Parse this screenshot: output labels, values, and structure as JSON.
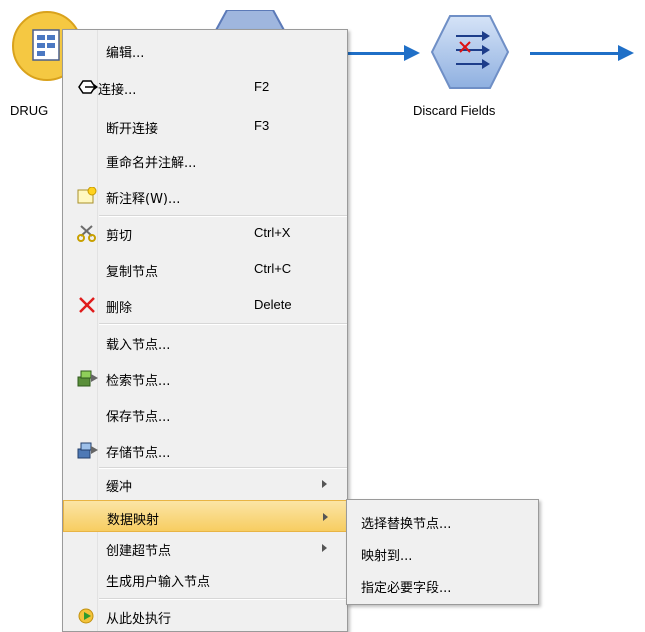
{
  "stream": {
    "source_node_label": "DRUG",
    "discard_node_label": "Discard Fields"
  },
  "menu": {
    "items": [
      {
        "label": "编辑...",
        "shortcut": ""
      },
      {
        "label": "连接...",
        "shortcut": "F2",
        "icon": "connect-icon"
      },
      {
        "label": "断开连接",
        "shortcut": "F3"
      },
      {
        "label": "重命名并注解...",
        "shortcut": ""
      },
      {
        "label": "新注释(W)...",
        "shortcut": "",
        "icon": "new-comment-icon"
      },
      {
        "label": "剪切",
        "shortcut": "Ctrl+X",
        "icon": "scissors-icon"
      },
      {
        "label": "复制节点",
        "shortcut": "Ctrl+C"
      },
      {
        "label": "删除",
        "shortcut": "Delete",
        "icon": "delete-icon"
      },
      {
        "label": "载入节点...",
        "shortcut": ""
      },
      {
        "label": "检索节点...",
        "shortcut": "",
        "icon": "retrieve-icon"
      },
      {
        "label": "保存节点...",
        "shortcut": ""
      },
      {
        "label": "存储节点...",
        "shortcut": "",
        "icon": "store-icon"
      },
      {
        "label": "缓冲",
        "submenu": true
      },
      {
        "label": "数据映射",
        "submenu": true,
        "active": true
      },
      {
        "label": "创建超节点",
        "submenu": true
      },
      {
        "label": "生成用户输入节点",
        "shortcut": ""
      },
      {
        "label": "从此处执行",
        "shortcut": "",
        "icon": "run-icon"
      }
    ]
  },
  "submenu": {
    "items": [
      {
        "label": "选择替换节点..."
      },
      {
        "label": "映射到..."
      },
      {
        "label": "指定必要字段..."
      }
    ]
  },
  "colors": {
    "flow": "#1f6fc7",
    "highlight": "#f7cd61",
    "menu_bg": "#f0f0f0"
  }
}
